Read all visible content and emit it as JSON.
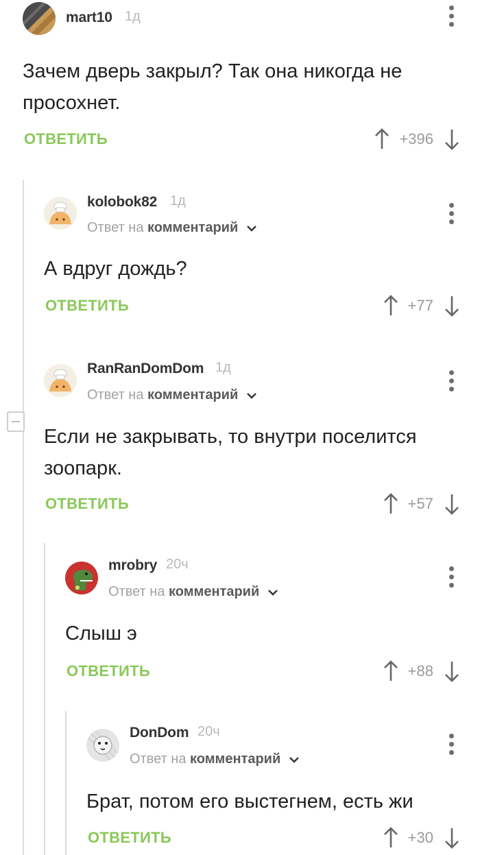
{
  "comments": [
    {
      "username": "mart10",
      "time": "1д",
      "reply_prefix": "",
      "reply_link": "",
      "text": "Зачем дверь закрыл? Так она никогда не просохнет.",
      "reply_label": "ОТВЕТИТЬ",
      "rating": "+396"
    },
    {
      "username": "kolobok82",
      "time": "1д",
      "reply_prefix": "Ответ на",
      "reply_link": "комментарий",
      "text": "А вдруг дождь?",
      "reply_label": "ОТВЕТИТЬ",
      "rating": "+77"
    },
    {
      "username": "RanRanDomDom",
      "time": "1д",
      "reply_prefix": "Ответ на",
      "reply_link": "комментарий",
      "text": "Если не закрывать, то внутри поселится зоопарк.",
      "reply_label": "ОТВЕТИТЬ",
      "rating": "+57"
    },
    {
      "username": "mrobry",
      "time": "20ч",
      "reply_prefix": "Ответ на",
      "reply_link": "комментарий",
      "text": "Слыш э",
      "reply_label": "ОТВЕТИТЬ",
      "rating": "+88"
    },
    {
      "username": "DonDom",
      "time": "20ч",
      "reply_prefix": "Ответ на",
      "reply_link": "комментарий",
      "text": "Брат, потом его выстегнем, есть жи",
      "reply_label": "ОТВЕТИТЬ",
      "rating": "+30"
    }
  ],
  "colors": {
    "accent": "#8ac858",
    "username": "#333333",
    "muted": "#a2a2a2"
  },
  "icons": [
    "upvote-arrow-icon",
    "downvote-arrow-icon",
    "more-vertical-icon",
    "chevron-down-icon",
    "collapse-thread-icon"
  ]
}
